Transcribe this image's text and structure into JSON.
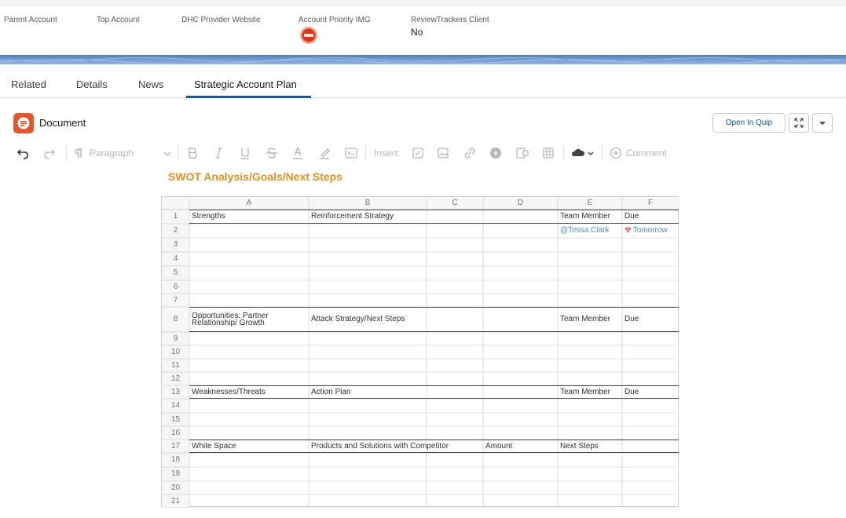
{
  "record_fields": [
    {
      "label": "Parent Account",
      "value": ""
    },
    {
      "label": "Top Account",
      "value": ""
    },
    {
      "label": "DHC Provider Website",
      "value": ""
    },
    {
      "label": "Account Priority IMG",
      "value": ""
    },
    {
      "label": "ReviewTrackers Client",
      "value": "No"
    }
  ],
  "priority_icon": "no-entry-icon",
  "tabs": [
    {
      "label": "Related",
      "active": false
    },
    {
      "label": "Details",
      "active": false
    },
    {
      "label": "News",
      "active": false
    },
    {
      "label": "Strategic Account Plan",
      "active": true
    }
  ],
  "document": {
    "title": "Document",
    "open_button": "Open In Quip",
    "expand_icon": "expand-icon",
    "menu_icon": "chevron-down-icon"
  },
  "toolbar": {
    "paragraph_label": "Paragraph",
    "insert_label": "Insert:",
    "comment_label": "Comment"
  },
  "heading": "SWOT Analysis/Goals/Next Steps",
  "colors": {
    "accent_orange": "#e8901e",
    "link_blue": "#4a8fd6",
    "tab_underline": "#0b5cab",
    "doc_icon": "#e4572e",
    "banner": "#6f9ccf"
  },
  "spreadsheet": {
    "columns": [
      "A",
      "B",
      "C",
      "D",
      "E",
      "F"
    ],
    "row_numbers": [
      "1",
      "2",
      "3",
      "4",
      "5",
      "6",
      "7",
      "8",
      "9",
      "10",
      "11",
      "12",
      "13",
      "14",
      "15",
      "16",
      "17",
      "18",
      "19",
      "20",
      "21"
    ],
    "cells": [
      {
        "row": 1,
        "col": "A",
        "text": "Strengths"
      },
      {
        "row": 1,
        "col": "B",
        "text": "Reinforcement Strategy"
      },
      {
        "row": 1,
        "col": "E",
        "text": "Team Member"
      },
      {
        "row": 1,
        "col": "F",
        "text": "Due"
      },
      {
        "row": 2,
        "col": "E",
        "text": "@Tessa Clark",
        "style": "link"
      },
      {
        "row": 2,
        "col": "F",
        "text": "Tomorrow",
        "style": "link"
      },
      {
        "row": 8,
        "col": "A",
        "text": "Opportunities: Partner Relationship/ Growth",
        "style": "wrap"
      },
      {
        "row": 8,
        "col": "B",
        "text": "Attack Strategy/Next Steps"
      },
      {
        "row": 8,
        "col": "E",
        "text": "Team Member"
      },
      {
        "row": 8,
        "col": "F",
        "text": "Due"
      },
      {
        "row": 13,
        "col": "A",
        "text": "Weaknesses/Threats"
      },
      {
        "row": 13,
        "col": "B",
        "text": "Action Plan"
      },
      {
        "row": 13,
        "col": "E",
        "text": "Team Member"
      },
      {
        "row": 13,
        "col": "F",
        "text": "Due"
      },
      {
        "row": 17,
        "col": "A",
        "text": "White Space"
      },
      {
        "row": 17,
        "col": "B",
        "text": "Products and Solutions with Competitor"
      },
      {
        "row": 17,
        "col": "D",
        "text": "Amount"
      },
      {
        "row": 17,
        "col": "E",
        "text": "Next Steps"
      }
    ]
  }
}
